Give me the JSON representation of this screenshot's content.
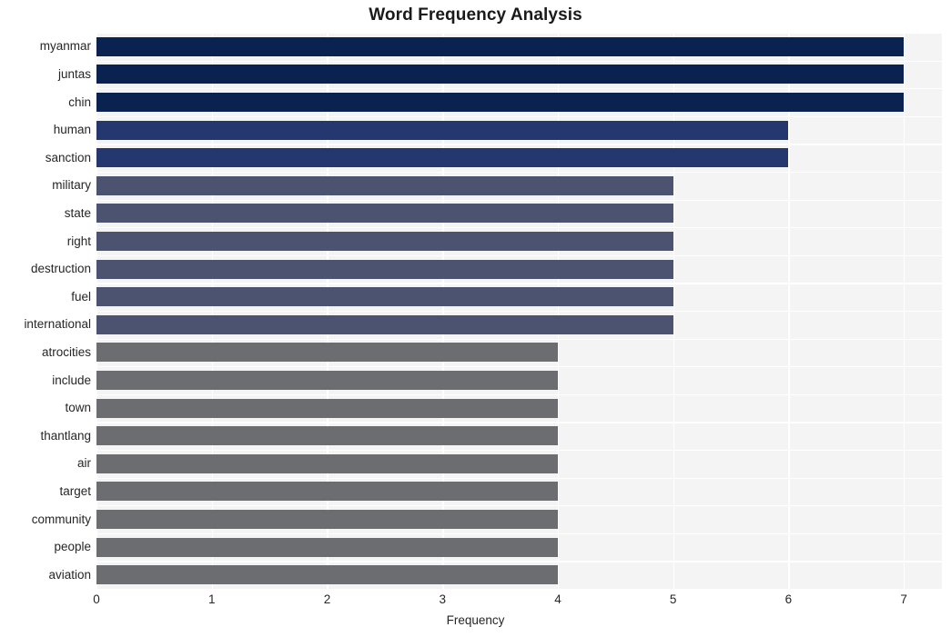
{
  "chart_data": {
    "type": "bar",
    "orientation": "horizontal",
    "title": "Word Frequency Analysis",
    "xlabel": "Frequency",
    "ylabel": "",
    "xlim": [
      0,
      7.33
    ],
    "xticks": [
      0,
      1,
      2,
      3,
      4,
      5,
      6,
      7
    ],
    "xticklabels": [
      "0",
      "1",
      "2",
      "3",
      "4",
      "5",
      "6",
      "7"
    ],
    "grid": true,
    "grid_color": "#ffffff",
    "plot_background": "#f4f4f5",
    "legend": "none",
    "categories": [
      "myanmar",
      "juntas",
      "chin",
      "human",
      "sanction",
      "military",
      "state",
      "right",
      "destruction",
      "fuel",
      "international",
      "atrocities",
      "include",
      "town",
      "thantlang",
      "air",
      "target",
      "community",
      "people",
      "aviation"
    ],
    "values": [
      7,
      7,
      7,
      6,
      6,
      5,
      5,
      5,
      5,
      5,
      5,
      4,
      4,
      4,
      4,
      4,
      4,
      4,
      4,
      4
    ],
    "bar_colors": [
      "#0a2250",
      "#0a2250",
      "#0a2250",
      "#24386f",
      "#24386f",
      "#4b5370",
      "#4b5370",
      "#4b5370",
      "#4b5370",
      "#4b5370",
      "#4b5370",
      "#6b6d71",
      "#6b6d71",
      "#6b6d71",
      "#6b6d71",
      "#6b6d71",
      "#6b6d71",
      "#6b6d71",
      "#6b6d71",
      "#6b6d71"
    ]
  },
  "colors": {
    "tier_7": "#0a2250",
    "tier_6": "#24386f",
    "tier_5": "#4b5370",
    "tier_4": "#6b6d71",
    "plot_bg": "#f4f4f5",
    "grid": "#ffffff",
    "text": "#262626",
    "title": "#1a1a1a"
  }
}
